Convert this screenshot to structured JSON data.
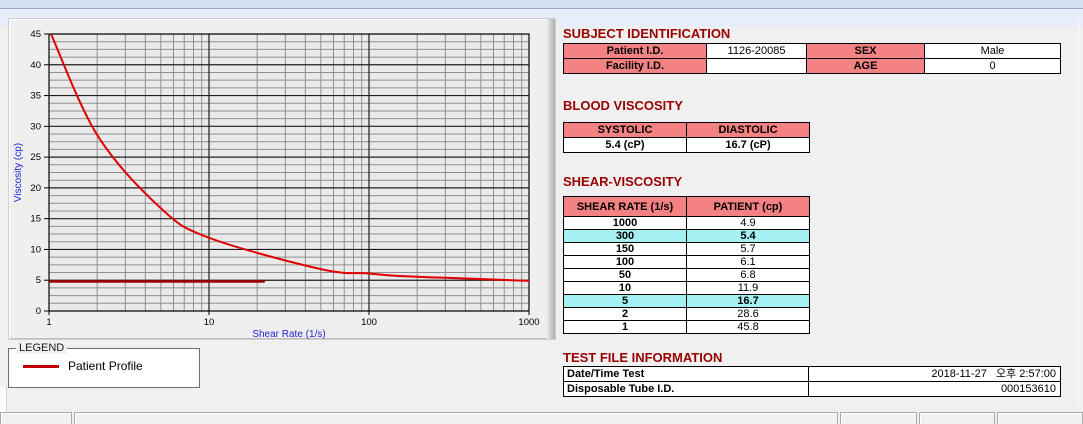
{
  "chart_data": {
    "type": "line",
    "title": "",
    "xlabel": "Shear Rate (1/s)",
    "ylabel": "Viscosity (cp)",
    "x_scale": "log",
    "xlim": [
      1,
      1000
    ],
    "ylim": [
      0,
      45
    ],
    "x_ticks": [
      1,
      10,
      100,
      1000
    ],
    "y_ticks": [
      0,
      5,
      10,
      15,
      20,
      25,
      30,
      35,
      40,
      45
    ],
    "grid": "on",
    "series": [
      {
        "name": "Patient Profile",
        "color": "#e10000",
        "line_width": 2,
        "x": [
          1,
          2,
          5,
          10,
          50,
          100,
          150,
          300,
          1000
        ],
        "y": [
          45.8,
          28.6,
          16.7,
          11.9,
          6.8,
          6.1,
          5.7,
          5.4,
          4.9
        ]
      },
      {
        "name": "baseline-marker",
        "color": "#a50000",
        "line_width": 2.5,
        "straight": true,
        "x": [
          1,
          22
        ],
        "y": [
          4.8,
          4.8
        ]
      }
    ],
    "legend": {
      "title": "LEGEND",
      "position": "below-left",
      "entries": [
        {
          "label": "Patient Profile",
          "color": "#c00000"
        }
      ]
    }
  },
  "sections": {
    "subject": {
      "title": "SUBJECT IDENTIFICATION",
      "rows": [
        {
          "label1": "Patient I.D.",
          "value1": "1126-20085",
          "label2": "SEX",
          "value2": "Male"
        },
        {
          "label1": "Facility I.D.",
          "value1": "",
          "label2": "AGE",
          "value2": "0"
        }
      ]
    },
    "blood_viscosity": {
      "title": "BLOOD VISCOSITY",
      "headers": [
        "SYSTOLIC",
        "DIASTOLIC"
      ],
      "values": [
        "5.4 (cP)",
        "16.7 (cP)"
      ]
    },
    "shear_viscosity": {
      "title": "SHEAR-VISCOSITY",
      "headers": [
        "SHEAR RATE (1/s)",
        "PATIENT (cp)"
      ],
      "highlighted_rates": [
        "300",
        "5"
      ],
      "rows": [
        {
          "rate": "1000",
          "value": "4.9"
        },
        {
          "rate": "300",
          "value": "5.4"
        },
        {
          "rate": "150",
          "value": "5.7"
        },
        {
          "rate": "100",
          "value": "6.1"
        },
        {
          "rate": "50",
          "value": "6.8"
        },
        {
          "rate": "10",
          "value": "11.9"
        },
        {
          "rate": "5",
          "value": "16.7"
        },
        {
          "rate": "2",
          "value": "28.6"
        },
        {
          "rate": "1",
          "value": "45.8"
        }
      ]
    },
    "test_file": {
      "title": "TEST FILE INFORMATION",
      "rows": [
        {
          "label": "Date/Time Test",
          "value": "2018-11-27   오후 2:57:00"
        },
        {
          "label": "Disposable Tube I.D.",
          "value": "000153610"
        }
      ]
    }
  },
  "colors": {
    "section_title": "#990000",
    "table_header_bg": "#f48282",
    "highlight_bg": "#a5f0f0",
    "axis_title": "#2323d6",
    "curve": "#e10000",
    "baseline": "#a50000",
    "top_band": "#d2e0f2"
  }
}
